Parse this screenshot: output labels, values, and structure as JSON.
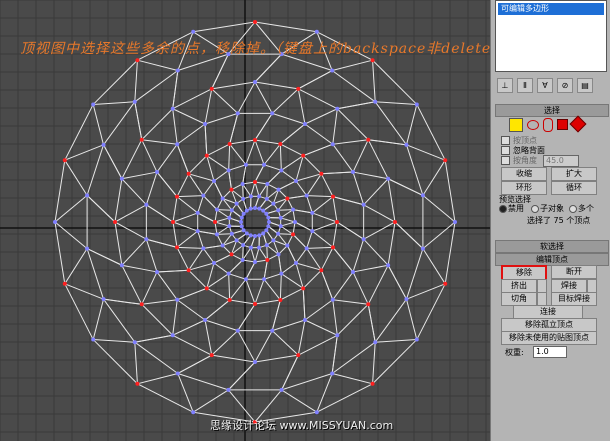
{
  "viewport": {
    "caption": "顶视图中选择这些多余的点，移除掉。（键盘上的backspace非delete）",
    "watermark": "思缘设计论坛 www.MISSYUAN.com"
  },
  "colors": {
    "wire": "#e8e8e8",
    "vertex_normal": "#8080ff",
    "vertex_selected": "#ff2020",
    "highlight": "#e01010"
  },
  "panel": {
    "stack_item": "可编辑多边形",
    "toolbar_icons": [
      "pin-icon",
      "show-end-icon",
      "make-unique-icon",
      "remove-modifier-icon",
      "configure-icon"
    ],
    "selection": {
      "title": "选择",
      "subobject_icons": [
        "vertex-icon",
        "edge-icon",
        "border-icon",
        "polygon-icon",
        "element-icon"
      ],
      "by_vertex": "按顶点",
      "ignore_backfacing": "忽略背面",
      "by_angle": "按角度",
      "angle_value": "45.0",
      "shrink": "收缩",
      "grow": "扩大",
      "ring": "环形",
      "loop": "循环",
      "preview_label": "预览选择",
      "preview_off": "禁用",
      "preview_subobj": "子对象",
      "preview_multi": "多个",
      "status": "选择了 75 个顶点"
    },
    "soft_selection": {
      "title": "软选择"
    },
    "edit_vertices": {
      "title": "编辑顶点",
      "remove": "移除",
      "break": "断开",
      "extrude": "挤出",
      "weld": "焊接",
      "chamfer": "切角",
      "target_weld": "目标焊接",
      "connect": "连接",
      "remove_isolated": "移除孤立顶点",
      "remove_unused_map": "移除未使用的贴图顶点",
      "weight_label": "权重:",
      "weight_value": "1.0"
    }
  }
}
